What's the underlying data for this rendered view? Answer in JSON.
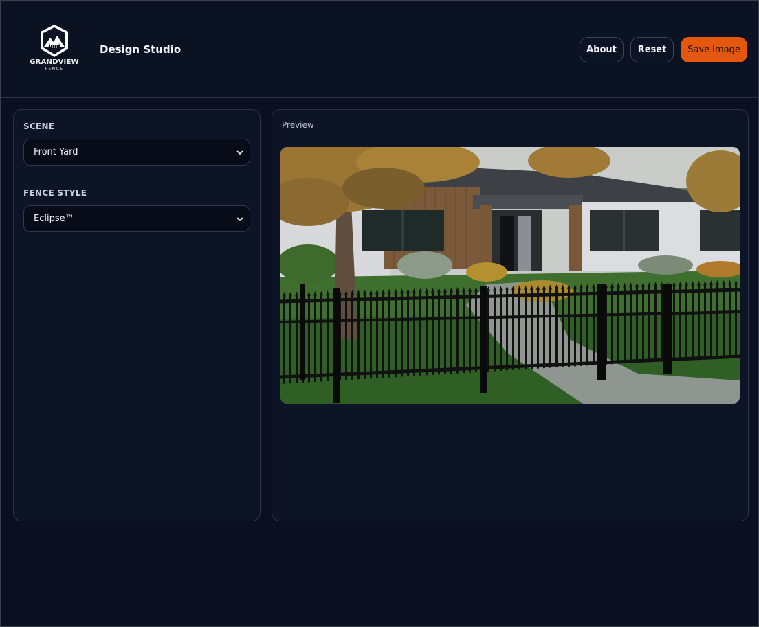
{
  "header": {
    "logo_line1": "GRANDVIEW",
    "logo_line2": "FENCE",
    "title": "Design Studio",
    "buttons": {
      "about": "About",
      "reset": "Reset",
      "save": "Save Image"
    }
  },
  "sidebar": {
    "scene_label": "SCENE",
    "scene_value": "Front Yard",
    "fence_style_label": "FENCE STYLE",
    "fence_style_value": "Eclipse™"
  },
  "preview": {
    "label": "Preview",
    "image_icon": "house-fence-scene"
  },
  "colors": {
    "background": "#0a1020",
    "panel": "#0c1426",
    "accent": "#e4570f"
  }
}
